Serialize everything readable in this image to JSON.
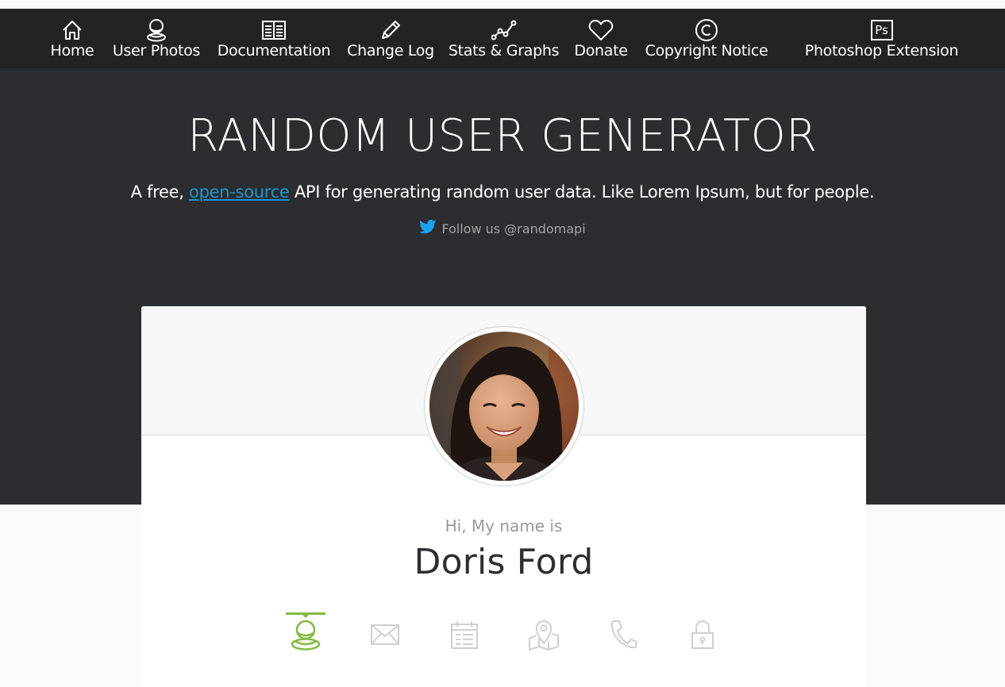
{
  "nav": {
    "items": [
      {
        "label": "Home",
        "icon": "home-icon"
      },
      {
        "label": "User Photos",
        "icon": "user-icon"
      },
      {
        "label": "Documentation",
        "icon": "book-icon"
      },
      {
        "label": "Change Log",
        "icon": "pencil-icon"
      },
      {
        "label": "Stats & Graphs",
        "icon": "graph-icon"
      },
      {
        "label": "Donate",
        "icon": "heart-icon"
      },
      {
        "label": "Copyright Notice",
        "icon": "copyright-icon"
      },
      {
        "label": "Photoshop Extension",
        "icon": "photoshop-icon",
        "icon_text": "Ps"
      }
    ]
  },
  "hero": {
    "title": "RANDOM USER GENERATOR",
    "subtitle_before": "A free, ",
    "subtitle_link": "open-source",
    "subtitle_after": " API for generating random user data. Like Lorem Ipsum, but for people.",
    "follow_text": "Follow us @randomapi"
  },
  "card": {
    "greeting": "Hi, My name is",
    "name": "Doris Ford",
    "tabs": [
      {
        "id": "name",
        "icon": "user-icon",
        "active": true
      },
      {
        "id": "email",
        "icon": "envelope-icon",
        "active": false
      },
      {
        "id": "birthday",
        "icon": "calendar-icon",
        "active": false
      },
      {
        "id": "location",
        "icon": "map-icon",
        "active": false
      },
      {
        "id": "phone",
        "icon": "phone-icon",
        "active": false
      },
      {
        "id": "password",
        "icon": "lock-icon",
        "active": false
      }
    ]
  },
  "colors": {
    "navbar": "#232323",
    "hero": "#2b2d31",
    "link": "#1b97c9",
    "accent": "#83ba43",
    "twitter": "#1da1f2",
    "inactive_icon": "#cfcfcf"
  }
}
